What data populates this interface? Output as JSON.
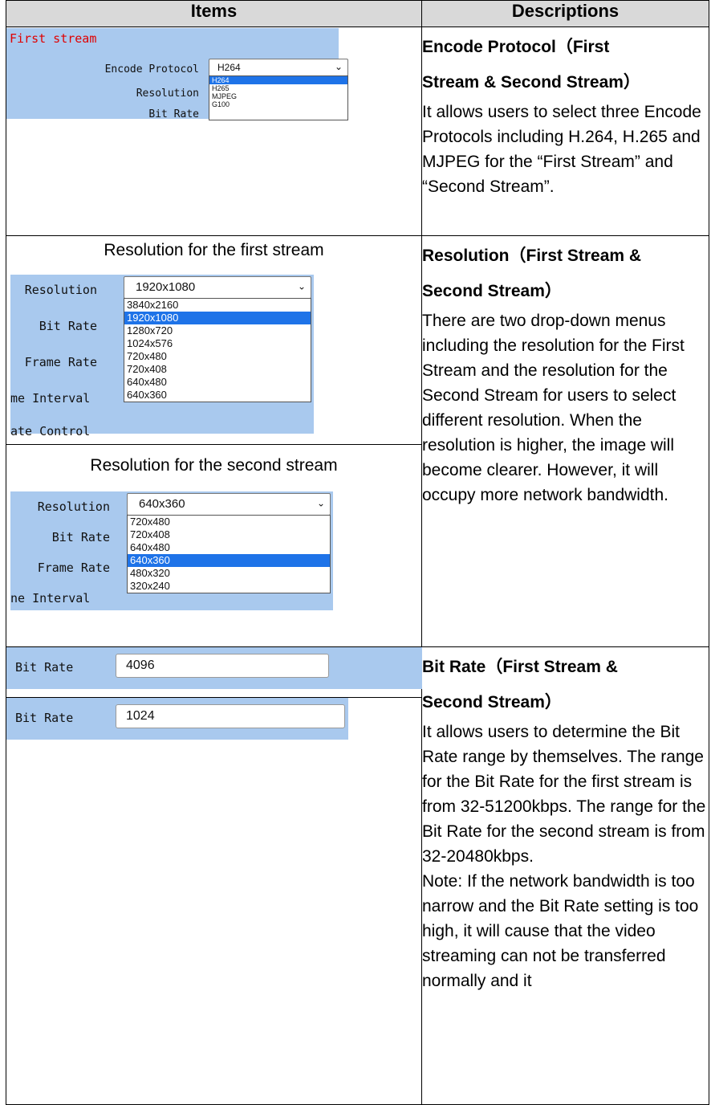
{
  "header": {
    "col1": "Items",
    "col2": "Descriptions"
  },
  "row1": {
    "ui": {
      "section_title": "First stream",
      "encode_label": "Encode Protocol",
      "encode_value": "H264",
      "resolution_label": "Resolution",
      "bitrate_label_cut": "Bit Rate",
      "options": [
        "H264",
        "H265",
        "MJPEG",
        "G100"
      ]
    },
    "title_line1": "Encode Protocol（First",
    "title_line2": "Stream & Second Stream）",
    "text": "It allows users to select three Encode Protocols including H.264, H.265 and MJPEG for the “First Stream” and “Second Stream”."
  },
  "row2": {
    "caption_first": "Resolution for the first stream",
    "caption_second": "Resolution for the second stream",
    "first_ui": {
      "labels": [
        "Resolution",
        "Bit Rate",
        "Frame Rate",
        "me Interval",
        "ate Control"
      ],
      "value": "1920x1080",
      "options": [
        "3840x2160",
        "1920x1080",
        "1280x720",
        "1024x576",
        "720x480",
        "720x408",
        "640x480",
        "640x360"
      ],
      "selected_index": 1
    },
    "second_ui": {
      "labels": [
        "Resolution",
        "Bit Rate",
        "Frame Rate",
        "ne Interval"
      ],
      "value": "640x360",
      "options": [
        "720x480",
        "720x408",
        "640x480",
        "640x360",
        "480x320",
        "320x240"
      ],
      "selected_index": 3
    },
    "title_line1": "Resolution（First Stream &",
    "title_line2": "Second Stream）",
    "text": "There are two drop-down menus including the resolution for the First Stream and the resolution for the Second Stream for users to select different resolution. When the resolution is higher, the image will become clearer. However, it will occupy more network bandwidth."
  },
  "row3": {
    "first_ui": {
      "label": "Bit Rate",
      "value": "4096"
    },
    "second_ui": {
      "label": "Bit Rate",
      "value": "1024"
    },
    "title_line1": "Bit Rate（First Stream &",
    "title_line2": "Second Stream）",
    "text": "It allows users to determine the Bit Rate range by themselves. The range for the Bit Rate for the first stream is from 32-51200kbps. The range for the Bit Rate for the second stream is from 32-20480kbps.\nNote: If the network bandwidth is too narrow and the Bit Rate setting is too high, it will cause that the video streaming can not be transferred normally and it"
  },
  "colors": {
    "panel": "#a9c9ee",
    "highlight": "#1e73e8",
    "header_bg": "#d9d9d9",
    "section_title": "#e00000"
  }
}
